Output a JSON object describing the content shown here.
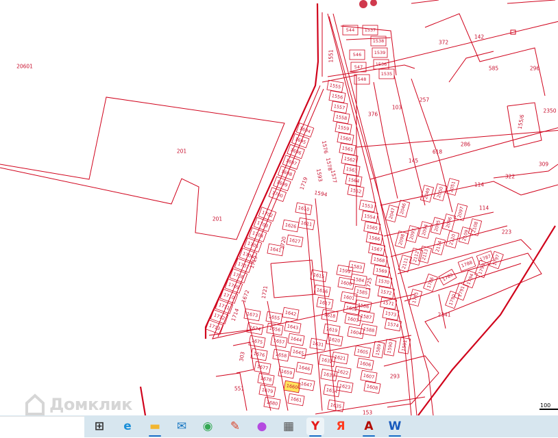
{
  "map": {
    "line_color": "#d0021b",
    "highlight_color": "#ffe45c",
    "highlighted_parcel": "1660",
    "parcels": [
      "20601",
      "201",
      "201",
      "1551",
      "372",
      "142",
      "585",
      "296",
      "376",
      "103",
      "257",
      "2350",
      "155/6",
      "286",
      "618",
      "145",
      "114",
      "322",
      "309",
      "114",
      "223",
      "2341",
      "551",
      "303",
      "293",
      "153",
      "1721",
      "1725",
      "544",
      "546",
      "547",
      "548",
      "1537",
      "1538",
      "1539",
      "1536",
      "1535",
      "1555",
      "1556",
      "1557",
      "1558",
      "1559",
      "1560",
      "1561",
      "1562",
      "1563",
      "1564",
      "1552",
      "1553",
      "1554",
      "1565",
      "1566",
      "1567",
      "1568",
      "1569",
      "1570",
      "1572",
      "1571",
      "1573",
      "1574",
      "1694",
      "1695",
      "1696",
      "1697",
      "1698",
      "1699",
      "1700",
      "1702",
      "1703",
      "1704",
      "1705",
      "1706",
      "1707",
      "1708",
      "1709",
      "1710",
      "1711",
      "1712",
      "1713",
      "1719",
      "1719",
      "1720",
      "1714",
      "1672",
      "1576",
      "1578",
      "1577",
      "1593",
      "1594",
      "1610",
      "1611",
      "1626",
      "1627",
      "1641",
      "1615",
      "1616",
      "1617",
      "1618",
      "1619",
      "1620",
      "1631",
      "1655",
      "1642",
      "1656",
      "1643",
      "1657",
      "1644",
      "1658",
      "1645",
      "1659",
      "1646",
      "1660",
      "1647",
      "1661",
      "1673",
      "1674",
      "1675",
      "1676",
      "1677",
      "1678",
      "1679",
      "1680",
      "1632",
      "1621",
      "1633",
      "1622",
      "1634",
      "1623",
      "1635",
      "1599",
      "1583",
      "1600",
      "1584",
      "1601",
      "1585",
      "1602",
      "1586",
      "1603",
      "1587",
      "1604",
      "1588",
      "1605",
      "1606",
      "1607",
      "1608",
      "1589",
      "1590",
      "1591",
      "2047",
      "2046",
      "2049",
      "2050",
      "2051",
      "2098",
      "2093",
      "2094",
      "2095",
      "2096",
      "2097",
      "2108",
      "2109",
      "2110",
      "2114",
      "2113",
      "2112",
      "2111",
      "1785",
      "1786",
      "1789",
      "1788",
      "1787",
      "1793",
      "1794",
      "1791",
      "1790",
      "1797"
    ],
    "scale_label": "100"
  },
  "watermark": {
    "text": "Домклик"
  },
  "taskbar": {
    "search_placeholder": "",
    "apps": [
      {
        "name": "task-view",
        "icon": "task-view-icon",
        "glyph": "⊞",
        "color": "#333333",
        "running": false,
        "active": false
      },
      {
        "name": "edge",
        "icon": "edge-icon",
        "glyph": "e",
        "color": "#1b8fd8",
        "running": false,
        "active": false
      },
      {
        "name": "file-explorer",
        "icon": "folder-icon",
        "glyph": "▬",
        "color": "#f2b630",
        "running": true,
        "active": false
      },
      {
        "name": "mail",
        "icon": "mail-icon",
        "glyph": "✉",
        "color": "#1a78c2",
        "running": false,
        "active": false
      },
      {
        "name": "chrome",
        "icon": "chrome-icon",
        "glyph": "◉",
        "color": "#34a853",
        "running": false,
        "active": false
      },
      {
        "name": "paint",
        "icon": "paint-icon",
        "glyph": "✎",
        "color": "#d9442a",
        "running": false,
        "active": false
      },
      {
        "name": "paint-3d",
        "icon": "drop-icon",
        "glyph": "●",
        "color": "#b44be0",
        "running": false,
        "active": false
      },
      {
        "name": "calculator",
        "icon": "calculator-icon",
        "glyph": "▦",
        "color": "#555555",
        "running": false,
        "active": false
      },
      {
        "name": "yandex-browser",
        "icon": "yandex-browser-icon",
        "glyph": "Y",
        "color": "#e51a1a",
        "running": true,
        "active": true
      },
      {
        "name": "yandex",
        "icon": "yandex-icon",
        "glyph": "Я",
        "color": "#ff3b1f",
        "running": false,
        "active": false
      },
      {
        "name": "acrobat",
        "icon": "pdf-icon",
        "glyph": "A",
        "color": "#b30b00",
        "running": true,
        "active": false
      },
      {
        "name": "word",
        "icon": "word-icon",
        "glyph": "W",
        "color": "#185abd",
        "running": true,
        "active": false
      }
    ]
  }
}
